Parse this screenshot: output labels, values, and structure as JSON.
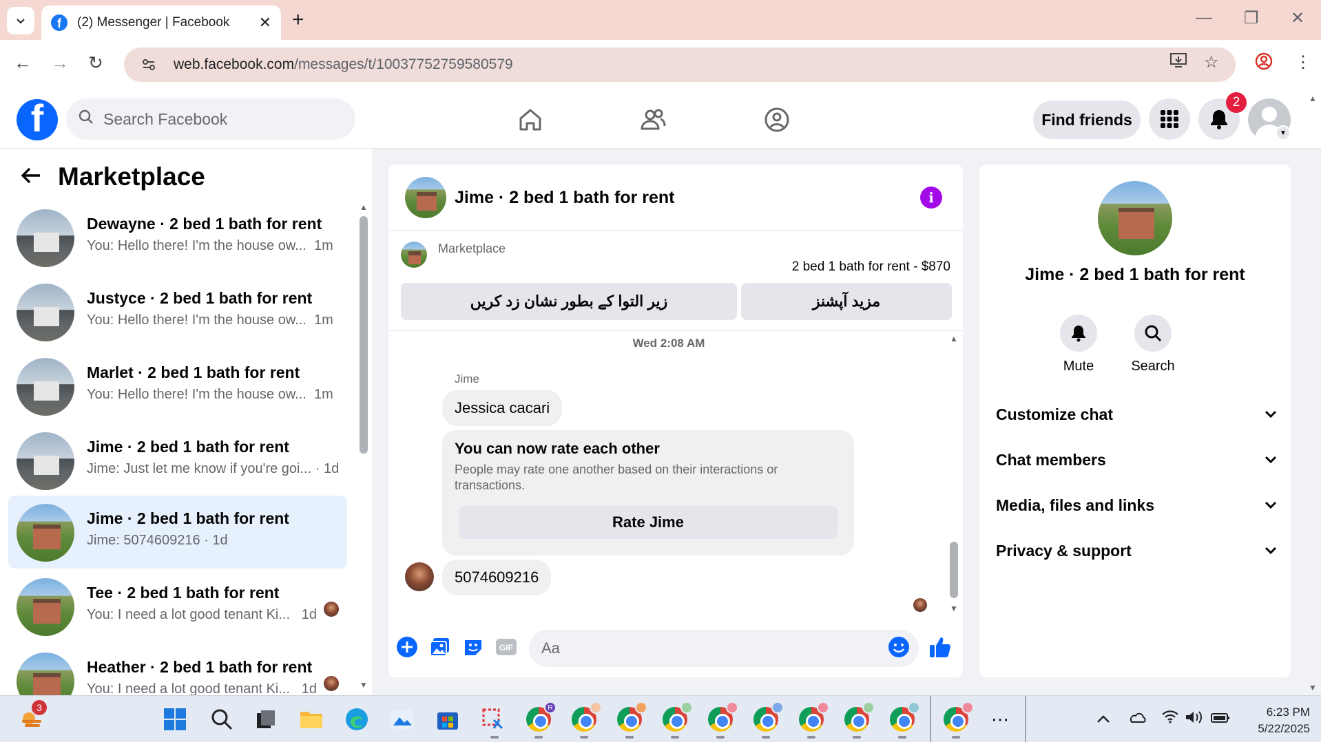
{
  "browser": {
    "tab_title": "(2) Messenger | Facebook",
    "url_host": "web.facebook.com",
    "url_path": "/messages/t/10037752759580579"
  },
  "header": {
    "search_placeholder": "Search Facebook",
    "find_friends": "Find friends",
    "notification_count": "2"
  },
  "left": {
    "title": "Marketplace",
    "conversations": [
      {
        "name": "Dewayne · 2 bed 1 bath for rent",
        "preview": "You: Hello there! I'm the house ow...",
        "time": "1m"
      },
      {
        "name": "Justyce · 2 bed 1 bath for rent",
        "preview": "You: Hello there! I'm the house ow...",
        "time": "1m"
      },
      {
        "name": "Marlet · 2 bed 1 bath for rent",
        "preview": "You: Hello there! I'm the house ow...",
        "time": "1m"
      },
      {
        "name": "Jime · 2 bed 1 bath for rent",
        "preview": "Jime: Just let me know if you're goi...",
        "time": "1d"
      },
      {
        "name": "Jime · 2 bed 1 bath for rent",
        "preview": "Jime: 5074609216 · 1d",
        "time": ""
      },
      {
        "name": "Tee · 2 bed 1 bath for rent",
        "preview": "You: I need a lot good tenant Ki...",
        "time": "1d"
      },
      {
        "name": "Heather · 2 bed 1 bath for rent",
        "preview": "You: I need a lot good tenant Ki...",
        "time": "1d"
      }
    ]
  },
  "chat": {
    "title": "Jime · 2 bed 1 bath for rent",
    "marketplace_label": "Marketplace",
    "listing": "2 bed 1 bath for rent - $870",
    "btn_mark_pending": "زیر التوا کے بطور نشان زد کریں",
    "btn_more_options": "مزید آپشنز",
    "timestamp": "Wed 2:08 AM",
    "sender": "Jime",
    "msg1": "Jessica cacari",
    "rate_title": "You can now rate each other",
    "rate_desc": "People may rate one another based on their interactions or transactions.",
    "rate_button": "Rate Jime",
    "msg2": "5074609216",
    "composer_placeholder": "Aa"
  },
  "details": {
    "name": "Jime · 2 bed 1 bath for rent",
    "mute": "Mute",
    "search": "Search",
    "sections": [
      "Customize chat",
      "Chat members",
      "Media, files and links",
      "Privacy & support"
    ]
  },
  "taskbar": {
    "weather_badge": "3",
    "time": "6:23 PM",
    "date": "5/22/2025"
  },
  "colors": {
    "fb_blue": "#0866ff",
    "messenger_purple": "#a30ae8",
    "active_row": "#e7f0fd",
    "tab_bar": "#f6d8d3"
  }
}
